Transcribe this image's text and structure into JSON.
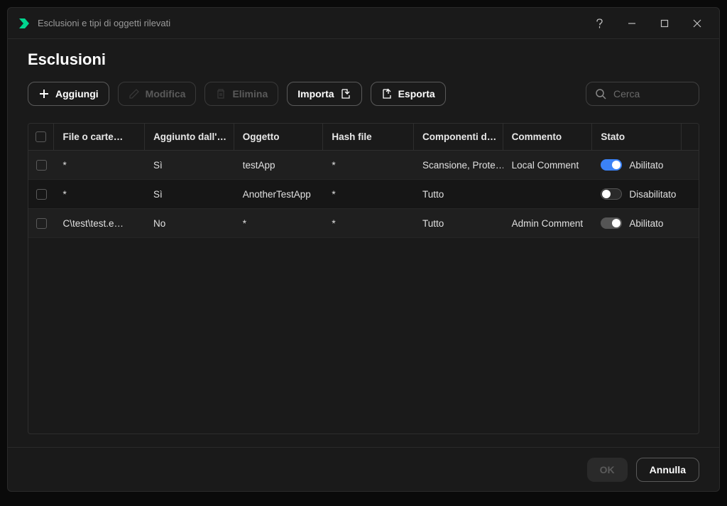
{
  "window": {
    "title": "Esclusioni e tipi di oggetti rilevati"
  },
  "page": {
    "heading": "Esclusioni"
  },
  "toolbar": {
    "add": "Aggiungi",
    "edit": "Modifica",
    "delete": "Elimina",
    "import": "Importa",
    "export": "Esporta"
  },
  "search": {
    "placeholder": "Cerca"
  },
  "columns": {
    "file": "File o carte…",
    "added": "Aggiunto dall'…",
    "object": "Oggetto",
    "hash": "Hash file",
    "components": "Componenti d…",
    "comment": "Commento",
    "state": "Stato"
  },
  "rows": [
    {
      "file": "*",
      "added": "Sì",
      "object": "testApp",
      "hash": "*",
      "components": "Scansione, Prote…",
      "comment": "Local Comment",
      "state_label": "Abilitato",
      "toggle": "on"
    },
    {
      "file": "*",
      "added": "Sì",
      "object": "AnotherTestApp",
      "hash": "*",
      "components": "Tutto",
      "comment": "",
      "state_label": "Disabilitato",
      "toggle": "off"
    },
    {
      "file": "C\\test\\test.e…",
      "added": "No",
      "object": "*",
      "hash": "*",
      "components": "Tutto",
      "comment": "Admin Comment",
      "state_label": "Abilitato",
      "toggle": "locked"
    }
  ],
  "footer": {
    "ok": "OK",
    "cancel": "Annulla"
  }
}
